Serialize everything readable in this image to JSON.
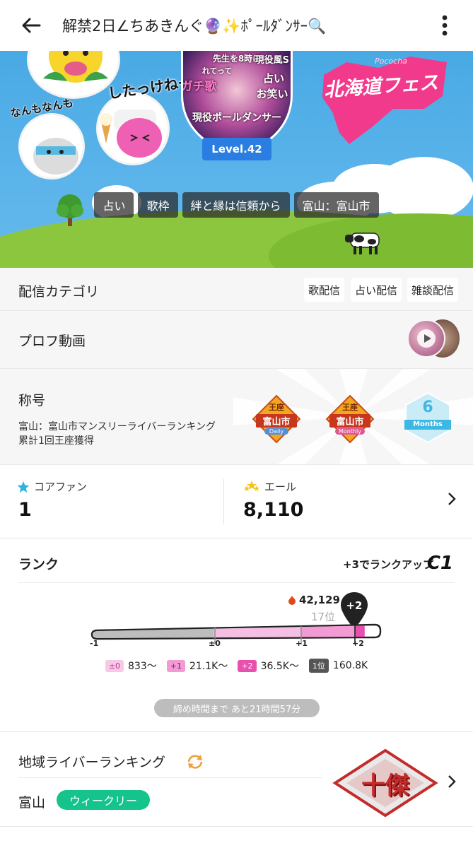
{
  "header": {
    "title": "解禁2日∠ちあきんぐ🔮✨ﾎﾟｰﾙﾀﾞﾝｻｰ🔍"
  },
  "banner": {
    "picture_texts": [
      "先生を8時に",
      "現役風S",
      "れてって",
      "ガチ歌",
      "占い",
      "お笑い",
      "現役ポールダンサー"
    ],
    "level": "Level.42",
    "stickers": {
      "left_text": "なんもなんも",
      "right_text": "したっけねー"
    },
    "fes": {
      "brand": "Pococha",
      "name": "北海道フェス"
    },
    "tags": [
      "占い",
      "歌枠",
      "絆と縁は信頼から",
      "富山：富山市"
    ]
  },
  "category": {
    "label": "配信カテゴリ",
    "items": [
      "歌配信",
      "占い配信",
      "雑談配信"
    ]
  },
  "movie": {
    "label": "プロフ動画"
  },
  "titles": {
    "label": "称号",
    "description": "富山：富山市マンスリーライバーランキング累計1回王座獲得",
    "emblems": [
      {
        "top": "王座",
        "city": "富山市",
        "period": "Daily"
      },
      {
        "top": "王座",
        "city": "富山市",
        "period": "Monthly"
      },
      {
        "top": "6",
        "city": "",
        "period": "Months"
      }
    ]
  },
  "stats": {
    "core_fan_label": "コアファン",
    "core_fan_value": "1",
    "yell_label": "エール",
    "yell_value": "8,110"
  },
  "rank": {
    "label": "ランク",
    "rank_up_text": "+3でランクアップ",
    "current_rank": "C1",
    "points": "42,129",
    "position": "17位",
    "marker": "+2",
    "progress": 0.95,
    "ticks": [
      "-1",
      "±0",
      "+1",
      "+2"
    ],
    "legend": [
      {
        "chip": "±0",
        "value": "833〜",
        "color": "#f6c9e6",
        "text_color": "#c2338f"
      },
      {
        "chip": "+1",
        "value": "21.1K〜",
        "color": "#f29ad3",
        "text_color": "#7d1660"
      },
      {
        "chip": "+2",
        "value": "36.5K〜",
        "color": "#e84fae",
        "text_color": "#ffffff"
      },
      {
        "chip": "1位",
        "value": "160.8K",
        "color": "#555555",
        "text_color": "#ffffff"
      }
    ],
    "deadline": "締め時間まで あと21時間57分"
  },
  "region": {
    "label": "地域ライバーランキング",
    "prefecture": "富山",
    "period": "ウィークリー",
    "badge": "十傑"
  },
  "colors": {
    "accent_blue": "#2a7de1",
    "pink": "#e84fae",
    "green": "#14c48c"
  }
}
